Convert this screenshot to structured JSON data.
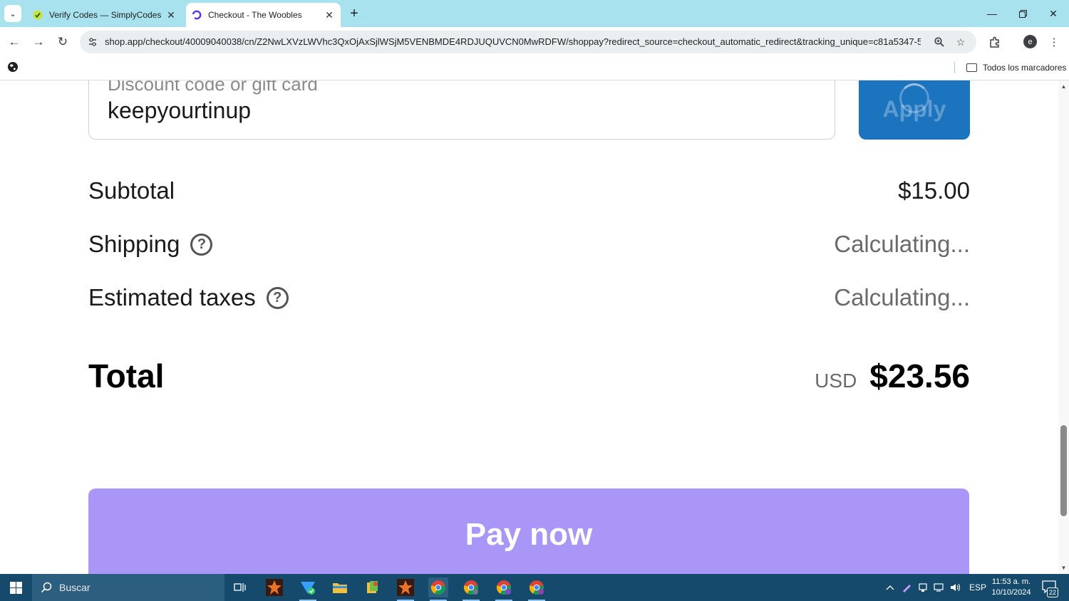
{
  "browser": {
    "tabs": [
      {
        "title": "Verify Codes — SimplyCodes",
        "active": false
      },
      {
        "title": "Checkout - The Woobles",
        "active": true
      }
    ],
    "url": "shop.app/checkout/40009040038/cn/Z2NwLXVzLWVhc3QxOjAxSjlWSjM5VENBMDE4RDJUQUVCN0MwRDFW/shoppay?redirect_source=checkout_automatic_redirect&tracking_unique=c81a5347-51...",
    "profile_initial": "e",
    "bookmarks_all_label": "Todos los marcadores"
  },
  "checkout": {
    "discount": {
      "placeholder": "Discount code or gift card",
      "value": "keepyourtinup",
      "apply_label": "Apply"
    },
    "subtotal": {
      "label": "Subtotal",
      "value": "$15.00"
    },
    "shipping": {
      "label": "Shipping",
      "value": "Calculating..."
    },
    "taxes": {
      "label": "Estimated taxes",
      "value": "Calculating..."
    },
    "total": {
      "label": "Total",
      "currency": "USD",
      "value": "$23.56"
    },
    "pay_label": "Pay now"
  },
  "taskbar": {
    "search_placeholder": "Buscar",
    "language": "ESP",
    "time": "11:53 a. m.",
    "date": "10/10/2024",
    "notification_count": "22"
  },
  "colors": {
    "tabstrip": "#a8e2ee",
    "apply_button": "#1c73be",
    "pay_button": "#a996f6",
    "taskbar": "#164a6d"
  }
}
